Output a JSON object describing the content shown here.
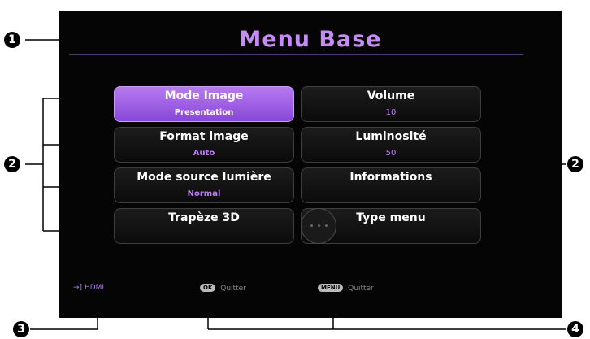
{
  "menu": {
    "title": "Menu Base",
    "items": [
      {
        "label": "Mode Image",
        "value": "Presentation",
        "selected": true
      },
      {
        "label": "Volume",
        "value": "10"
      },
      {
        "label": "Format image",
        "value": "Auto"
      },
      {
        "label": "Luminosité",
        "value": "50"
      },
      {
        "label": "Mode source lumière",
        "value": "Normal"
      },
      {
        "label": "Informations",
        "value": ""
      },
      {
        "label": "Trapèze 3D",
        "value": ""
      },
      {
        "label": "Type menu",
        "value": ""
      }
    ]
  },
  "footer": {
    "source": "HDMI",
    "ok_key": "OK",
    "ok_label": "Quitter",
    "menu_key": "MENU",
    "menu_label": "Quitter"
  },
  "callouts": [
    "1",
    "2",
    "2",
    "3",
    "4"
  ],
  "colors": {
    "accent": "#c58cf3",
    "selected_bg": "#a062e6",
    "screen_bg": "#050505"
  }
}
